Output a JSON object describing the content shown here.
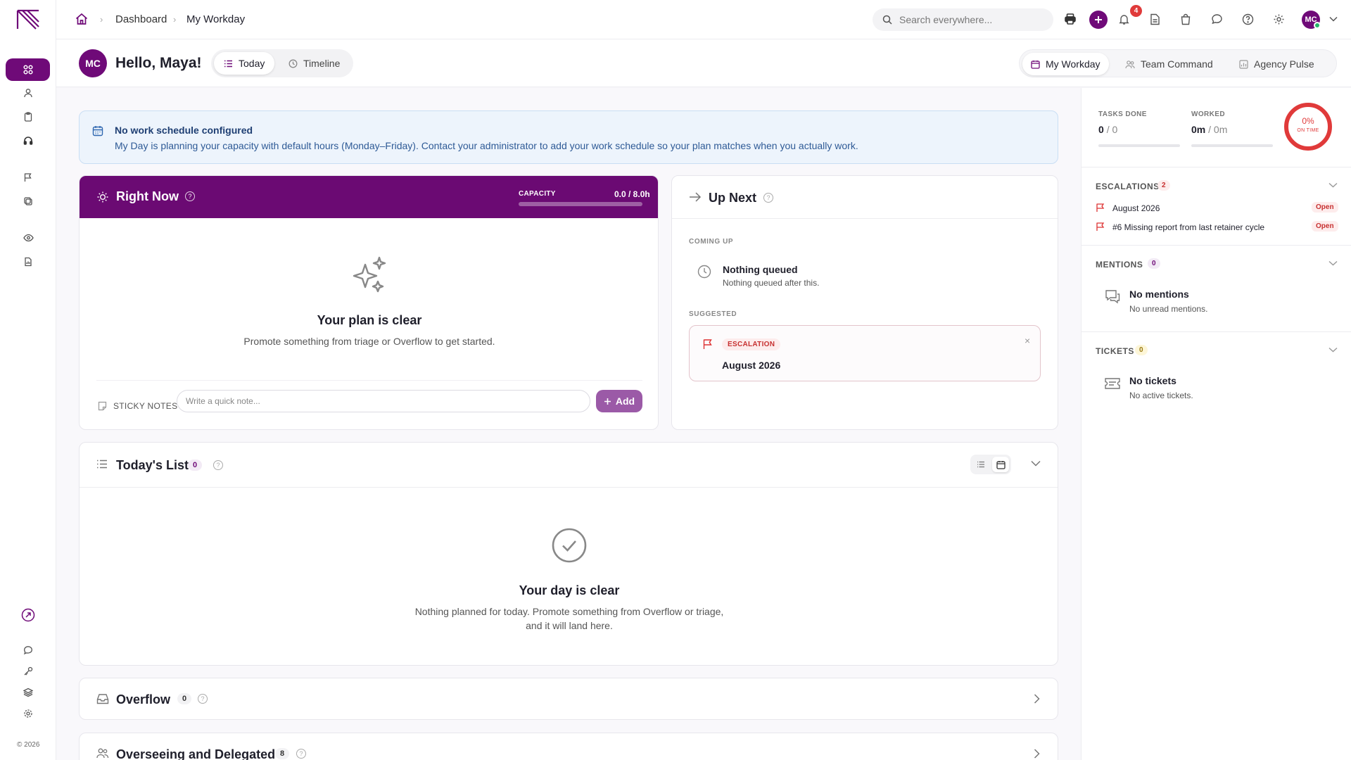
{
  "header": {
    "breadcrumb": [
      "Dashboard",
      "My Workday"
    ],
    "search_placeholder": "Search everywhere...",
    "notification_count": "4",
    "avatar_initials": "MC"
  },
  "sidebar": {
    "copyright": "© 2026",
    "icons": [
      "grid-icon",
      "user-icon",
      "clipboard-icon",
      "headset-icon",
      "flag-icon",
      "tags-icon",
      "eye-icon",
      "report-icon"
    ],
    "bottom_icons": [
      "rocket-icon",
      "chat-icon",
      "key-icon",
      "layers-icon",
      "settings-icon"
    ]
  },
  "greeting": {
    "avatar": "MC",
    "text": "Hello, Maya!",
    "view_tabs": [
      "Today",
      "Timeline"
    ],
    "active_view": "Today"
  },
  "workspace_tabs": [
    "My Workday",
    "Team Command",
    "Agency Pulse"
  ],
  "active_workspace": "My Workday",
  "alert": {
    "title": "No work schedule configured",
    "text": "My Day is planning your capacity with default hours (Monday–Friday). Contact your administrator to add your work schedule so your plan matches when you actually work."
  },
  "right_now": {
    "title": "Right Now",
    "help": "?",
    "capacity_label": "CAPACITY",
    "capacity_value": "0.0 / 8.0h",
    "capacity_fraction": 0,
    "empty_title": "Your plan is clear",
    "empty_sub": "Promote something from triage or Overflow to get started.",
    "sticky_label": "STICKY NOTES",
    "sticky_placeholder": "Write a quick note...",
    "add_label": "Add"
  },
  "up_next": {
    "title": "Up Next",
    "help": "?",
    "coming_up_label": "COMING UP",
    "queued_title": "Nothing queued",
    "queued_sub": "Nothing queued after this.",
    "suggested_label": "SUGGESTED",
    "suggested": {
      "tag": "ESCALATION",
      "title": "August 2026",
      "close": "×"
    }
  },
  "todays_list": {
    "title": "Today's List",
    "count": "0",
    "help": "?",
    "empty_title": "Your day is clear",
    "empty_sub_1": "Nothing planned for today. Promote something from Overflow or triage,",
    "empty_sub_2": "and it will land here."
  },
  "overflow": {
    "title": "Overflow",
    "count": "0",
    "help": "?"
  },
  "overseeing": {
    "title": "Overseeing and Delegated",
    "count": "8",
    "help": "?"
  },
  "stats": {
    "tasks_done_label": "TASKS DONE",
    "tasks_done_value": "0",
    "tasks_done_total": "/ 0",
    "worked_label": "WORKED",
    "worked_value": "0m",
    "worked_total": "/ 0m",
    "on_time_pct": "0%",
    "on_time_label": "ON TIME"
  },
  "escalations": {
    "label": "ESCALATIONS",
    "count": "2",
    "items": [
      {
        "title": "August 2026",
        "status": "Open"
      },
      {
        "title": "#6 Missing report from last retainer cycle",
        "status": "Open"
      }
    ]
  },
  "mentions": {
    "label": "MENTIONS",
    "count": "0",
    "empty_title": "No mentions",
    "empty_sub": "No unread mentions."
  },
  "tickets": {
    "label": "TICKETS",
    "count": "0",
    "empty_title": "No tickets",
    "empty_sub": "No active tickets."
  },
  "colors": {
    "brand": "#6f0a78",
    "danger": "#e03a3a",
    "info_bg": "#edf4fc"
  }
}
